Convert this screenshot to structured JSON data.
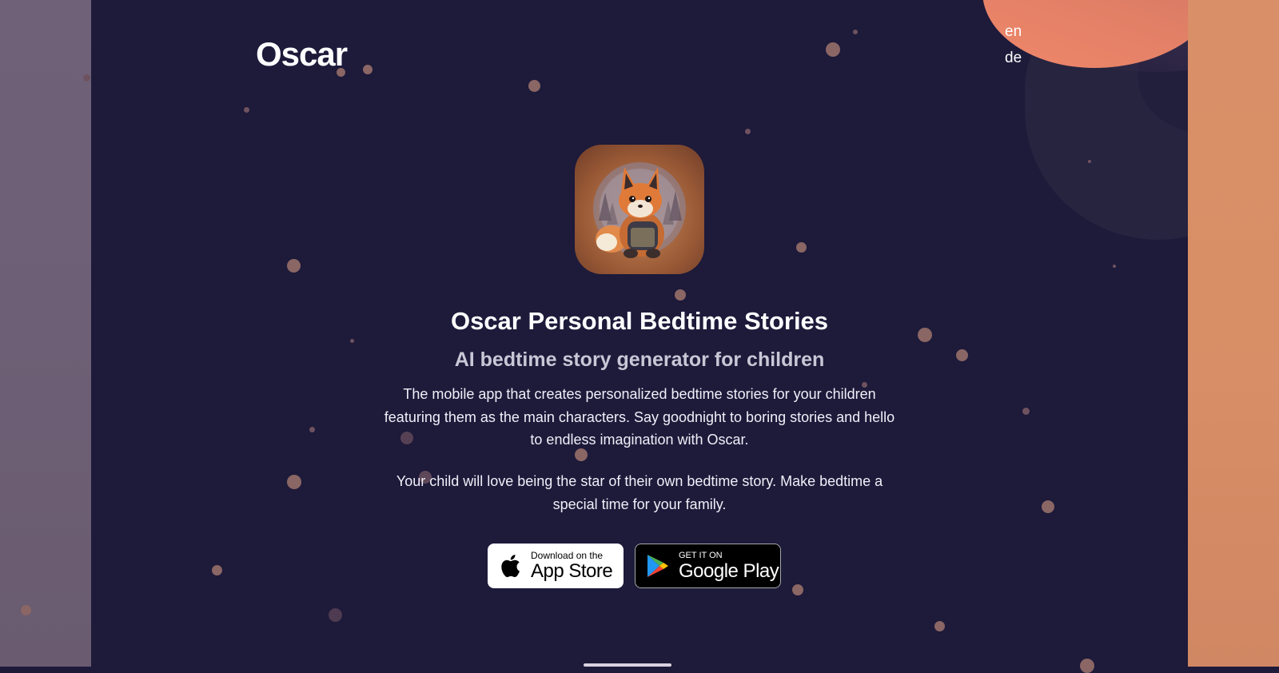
{
  "header": {
    "logo_text": "Oscar",
    "languages": [
      "en",
      "de"
    ]
  },
  "hero": {
    "app_icon": "fox-reading-book-icon",
    "title": "Oscar Personal Bedtime Stories",
    "subtitle": "AI bedtime story generator for children",
    "paragraph_1": "The mobile app that creates personalized bedtime stories for your children featuring them as the main characters. Say goodnight to boring stories and hello to endless imagination with Oscar.",
    "paragraph_2": "Your child will love being the star of their own bedtime story. Make bedtime a special time for your family."
  },
  "store_buttons": {
    "apple": {
      "small_text": "Download on the",
      "big_text": "App Store",
      "icon": "apple-icon"
    },
    "google": {
      "small_text": "GET IT ON",
      "big_text": "Google Play",
      "icon": "google-play-icon"
    }
  },
  "colors": {
    "background": "#1d1a3a",
    "accent_orange": "#e07f66",
    "left_panel": "#6f6278",
    "right_panel": "#d99068",
    "dots": "#8a6664"
  }
}
